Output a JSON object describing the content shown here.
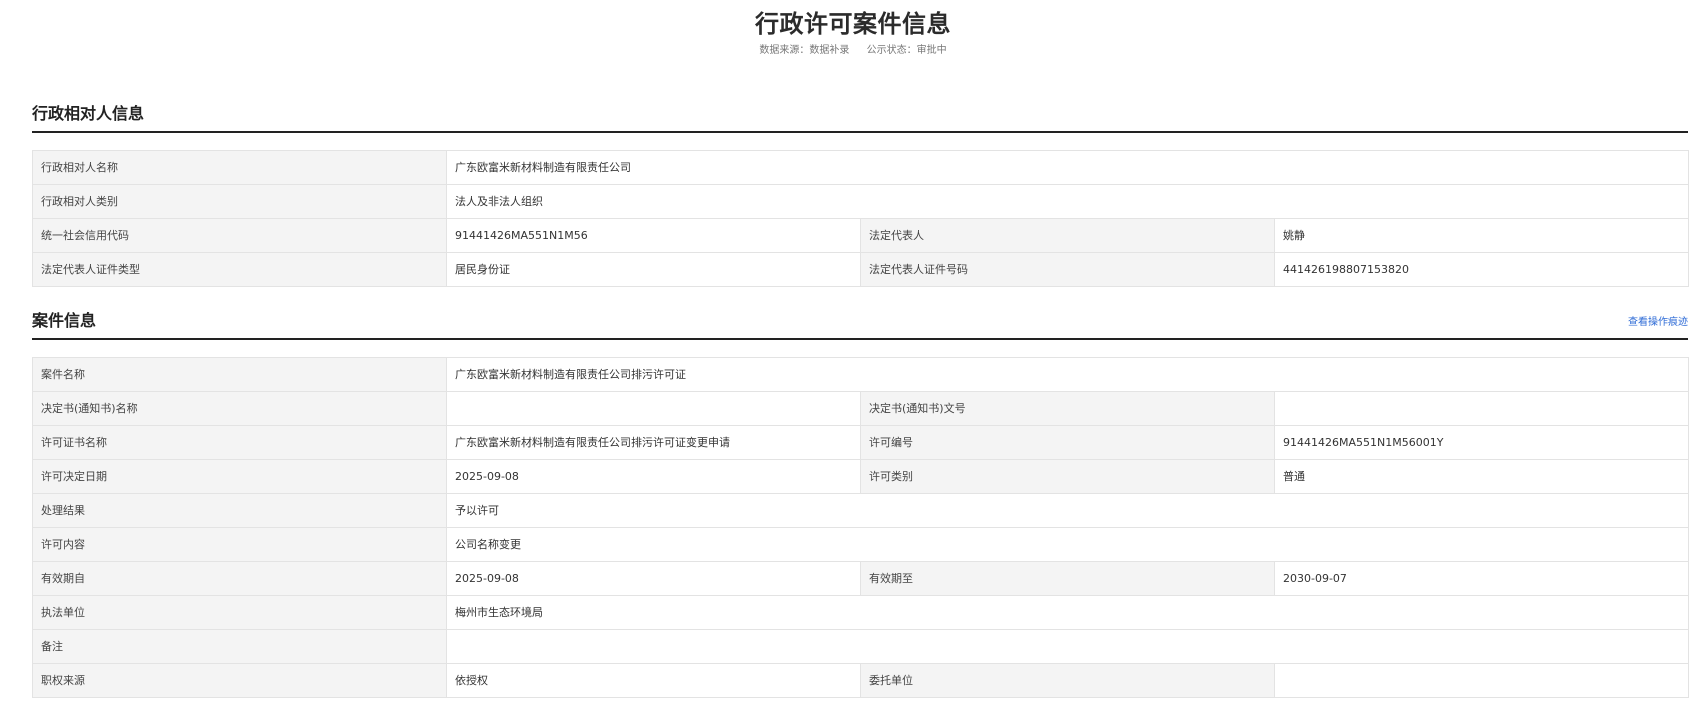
{
  "page": {
    "title": "行政许可案件信息",
    "data_source": "数据来源：数据补录",
    "public_status": "公示状态：审批中"
  },
  "party_section": {
    "title": "行政相对人信息",
    "rows": [
      {
        "label": "行政相对人名称",
        "value": "广东欧富米新材料制造有限责任公司"
      },
      {
        "label": "行政相对人类别",
        "value": "法人及非法人组织"
      },
      {
        "label": "统一社会信用代码",
        "value": "91441426MA551N1M56",
        "label2": "法定代表人",
        "value2": "姚静"
      },
      {
        "label": "法定代表人证件类型",
        "value": "居民身份证",
        "label2": "法定代表人证件号码",
        "value2": "441426198807153820"
      }
    ]
  },
  "case_section": {
    "title": "案件信息",
    "link_label": "查看操作痕迹",
    "rows": [
      {
        "label": "案件名称",
        "value": "广东欧富米新材料制造有限责任公司排污许可证"
      },
      {
        "label": "决定书(通知书)名称",
        "value": "",
        "label2": "决定书(通知书)文号",
        "value2": ""
      },
      {
        "label": "许可证书名称",
        "value": "广东欧富米新材料制造有限责任公司排污许可证变更申请",
        "label2": "许可编号",
        "value2": "91441426MA551N1M56001Y"
      },
      {
        "label": "许可决定日期",
        "value": "2025-09-08",
        "label2": "许可类别",
        "value2": "普通"
      },
      {
        "label": "处理结果",
        "value": "予以许可"
      },
      {
        "label": "许可内容",
        "value": "公司名称变更"
      },
      {
        "label": "有效期自",
        "value": "2025-09-08",
        "label2": "有效期至",
        "value2": "2030-09-07"
      },
      {
        "label": "执法单位",
        "value": "梅州市生态环境局"
      },
      {
        "label": "备注",
        "value": ""
      },
      {
        "label": "职权来源",
        "value": "依授权",
        "label2": "委托单位",
        "value2": ""
      }
    ]
  }
}
